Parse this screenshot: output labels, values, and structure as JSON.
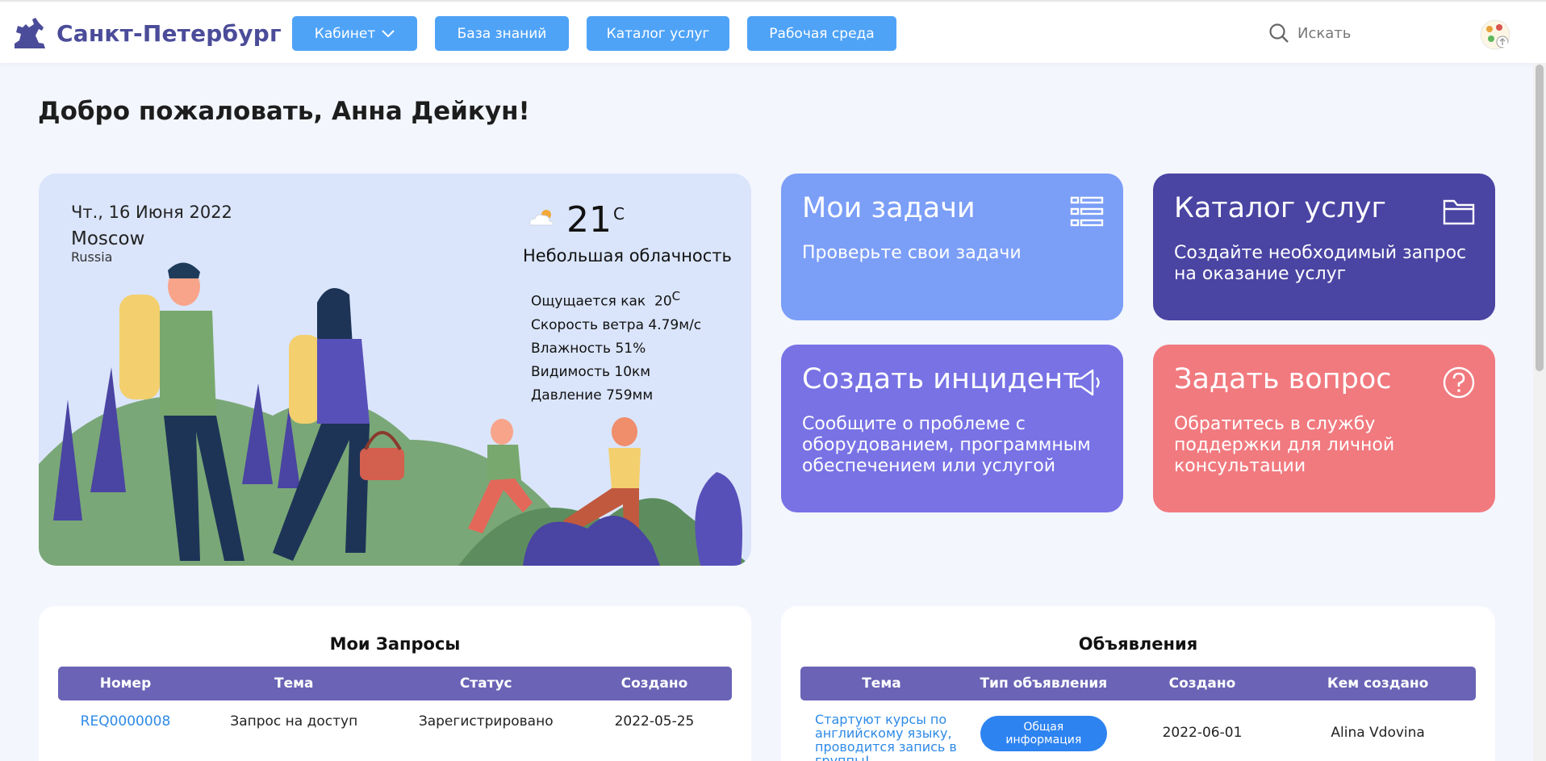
{
  "header": {
    "logo_text": "Санкт-Петербург",
    "nav": [
      {
        "label": "Кабинет"
      },
      {
        "label": "База знаний"
      },
      {
        "label": "Каталог услуг"
      },
      {
        "label": "Рабочая среда"
      }
    ],
    "search_placeholder": "Искать"
  },
  "welcome": "Добро пожаловать, Анна Дейкун!",
  "weather": {
    "date": "Чт., 16 Июня 2022",
    "city": "Moscow",
    "country": "Russia",
    "temp": "21",
    "temp_unit": "C",
    "description": "Небольшая облачность",
    "feels_like_label": "Ощущается как",
    "feels_like_value": "20",
    "feels_like_unit": "C",
    "wind": "Скорость ветра  4.79м/с",
    "humidity": "Влажность  51%",
    "visibility": "Видимость  10км",
    "pressure": "Давление  759мм"
  },
  "tiles": [
    {
      "title": "Мои задачи",
      "subtitle": "Проверьте свои задачи",
      "color": "#7b9ef7",
      "icon": "list-icon"
    },
    {
      "title": "Каталог услуг",
      "subtitle": "Создайте необходимый запрос на оказание услуг",
      "color": "#4a44a3",
      "icon": "folder-icon"
    },
    {
      "title": "Создать инцидент",
      "subtitle": "Сообщите о проблеме с оборудованием, программным обеспечением или услугой",
      "color": "#7872e5",
      "icon": "megaphone-icon"
    },
    {
      "title": "Задать вопрос",
      "subtitle": "Обратитесь в службу поддержки для личной консультации",
      "color": "#f17a7f",
      "icon": "question-icon"
    }
  ],
  "requests": {
    "title": "Мои Запросы",
    "columns": [
      "Номер",
      "Тема",
      "Статус",
      "Создано"
    ],
    "rows": [
      {
        "number": "REQ0000008",
        "topic": "Запрос на доступ",
        "status": "Зарегистрировано",
        "created": "2022-05-25"
      }
    ]
  },
  "announcements": {
    "title": "Объявления",
    "columns": [
      "Тема",
      "Тип объявления",
      "Создано",
      "Кем создано"
    ],
    "rows": [
      {
        "topic": "Стартуют курсы по английскому языку, проводится запись в группы!",
        "type": "Общая информация",
        "created": "2022-06-01",
        "author": "Alina Vdovina"
      }
    ]
  }
}
